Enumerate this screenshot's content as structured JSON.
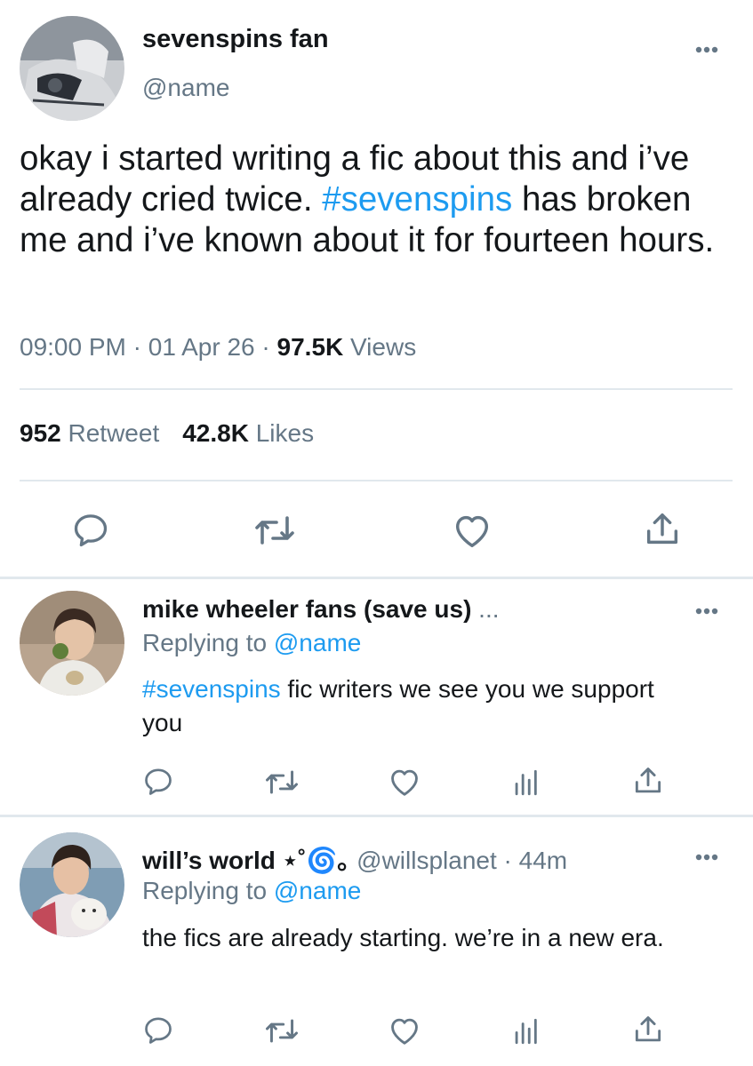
{
  "main_tweet": {
    "display_name": "sevenspins fan",
    "handle": "@name",
    "text_before_tag": "okay i started writing a fic about this and i’ve already cried twice. ",
    "hashtag": "#sevenspins",
    "text_after_tag": " has broken me and i’ve known about it for fourteen hours.",
    "time": "09:00 PM",
    "date": "01 Apr 26",
    "views_count": "97.5K",
    "views_label": "Views",
    "retweet_count": "952",
    "retweet_label": "Retweet",
    "likes_count": "42.8K",
    "likes_label": "Likes",
    "separator": " · "
  },
  "replies": [
    {
      "display_name": "mike wheeler fans (save us)",
      "name_suffix": " ...",
      "replying_label": "Replying to ",
      "replying_handle": "@name",
      "hashtag": "#sevenspins",
      "text": " fic writers we see you we support you"
    },
    {
      "display_name": "will’s world ⋆˚🌀｡",
      "handle": "@willsplanet",
      "time": " · 44m",
      "replying_label": "Replying to ",
      "replying_handle": "@name",
      "text": "the fics are already starting. we’re in a new era."
    }
  ],
  "colors": {
    "accent": "#1d9bf0",
    "secondary_text": "#657786",
    "divider": "#e1e8ed"
  },
  "icons": [
    "reply-icon",
    "retweet-icon",
    "like-icon",
    "share-icon",
    "analytics-icon",
    "more-icon"
  ]
}
